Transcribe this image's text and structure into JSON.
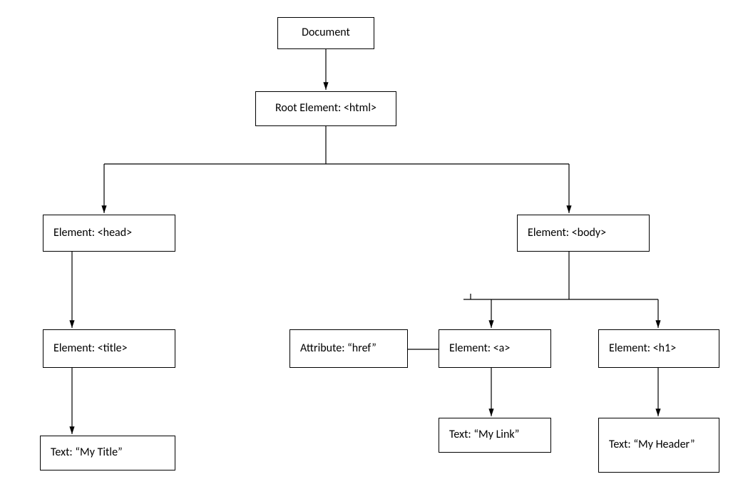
{
  "nodes": {
    "document": "Document",
    "root": "Root Element: <html>",
    "head": "Element: <head>",
    "body": "Element: <body>",
    "title": "Element: <title>",
    "href": "Attribute: “href”",
    "a": "Element: <a>",
    "h1": "Element: <h1>",
    "text_title": "Text: “My Title”",
    "text_link": "Text: “My Link”",
    "text_header": "Text: “My Header”"
  }
}
